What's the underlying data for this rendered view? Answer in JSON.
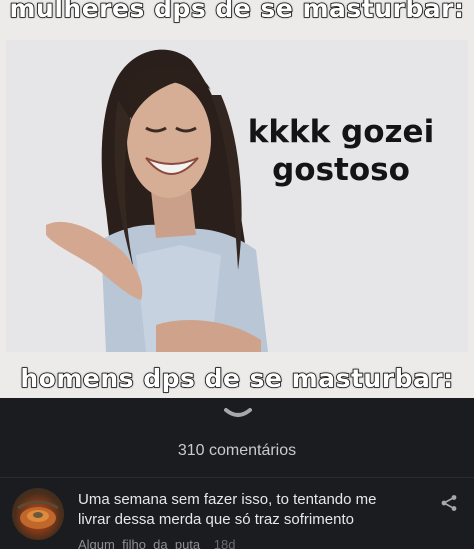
{
  "meme": {
    "top_caption": "mulheres dps de se masturbar:",
    "speech_line_1": "kkkk gozei",
    "speech_line_2": "gostoso",
    "bottom_caption": "homens dps de se masturbar:"
  },
  "comments": {
    "count_label": "310 comentários",
    "items": [
      {
        "text": "Uma semana sem fazer isso, to tentando me livrar dessa merda que só traz sofrimento",
        "author": "Algum_filho_da_puta",
        "time": "18d"
      }
    ]
  },
  "colors": {
    "background": "#1b1c20",
    "comment_text": "#e6e7ea",
    "meta_text": "#8d8e93"
  },
  "icons": [
    "chevron-down-icon",
    "share-icon"
  ]
}
